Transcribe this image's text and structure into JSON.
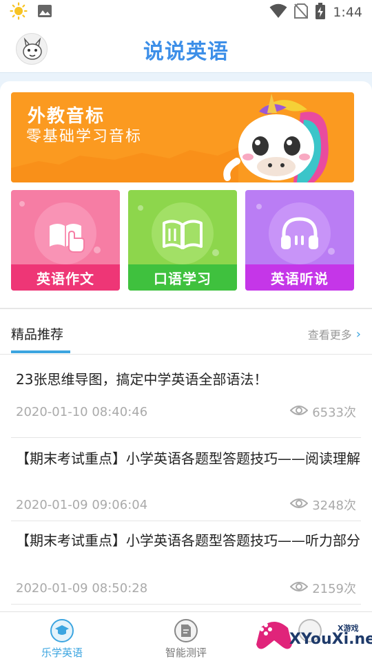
{
  "status_bar": {
    "time": "1:44"
  },
  "header": {
    "title": "说说英语"
  },
  "banner": {
    "title": "外教音标",
    "subtitle": "零基础学习音标"
  },
  "tiles": [
    {
      "label": "英语作文",
      "icon": "book-hand-icon"
    },
    {
      "label": "口语学习",
      "icon": "open-book-icon"
    },
    {
      "label": "英语听说",
      "icon": "headphones-icon"
    }
  ],
  "section": {
    "tab_label": "精品推荐",
    "more_label": "查看更多"
  },
  "articles": [
    {
      "title": "23张思维导图，搞定中学英语全部语法！",
      "date": "2020-01-10 08:40:46",
      "views": "6533次"
    },
    {
      "title": "【期末考试重点】小学英语各题型答题技巧——阅读理解",
      "date": "2020-01-09 09:06:04",
      "views": "3248次"
    },
    {
      "title": "【期末考试重点】小学英语各题型答题技巧——听力部分",
      "date": "2020-01-09 08:50:28",
      "views": "2159次"
    }
  ],
  "bottom_nav": {
    "items": [
      {
        "label": "乐学英语",
        "active": true
      },
      {
        "label": "智能测评",
        "active": false
      }
    ]
  },
  "watermark": {
    "text": "XYouXi.net",
    "small": "X游戏"
  },
  "colors": {
    "accent": "#3ca5e0",
    "title_blue": "#3d8fe8",
    "banner_orange": "#fb9a20"
  }
}
